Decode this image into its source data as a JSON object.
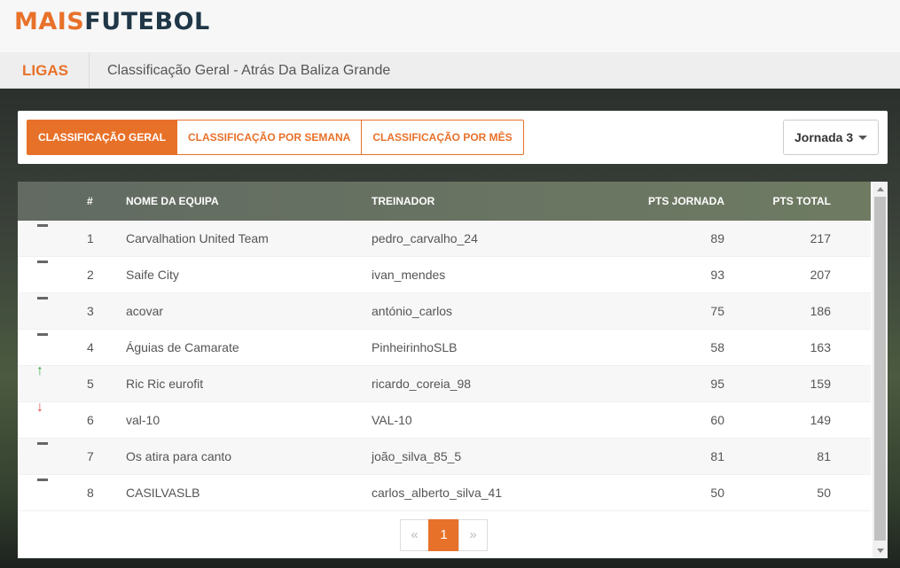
{
  "logo": {
    "part1": "MAIS",
    "part2": "FUTEBOL"
  },
  "subnav": {
    "section": "LIGAS",
    "title": "Classificação Geral - Atrás Da Baliza Grande"
  },
  "tabs": [
    {
      "label": "Classificação Geral",
      "active": true
    },
    {
      "label": "Classificação por Semana",
      "active": false
    },
    {
      "label": "Classificação por Mês",
      "active": false
    }
  ],
  "round_select": {
    "value": "Jornada 3"
  },
  "table": {
    "headers": {
      "num": "#",
      "team": "Nome da Equipa",
      "coach": "Treinador",
      "pts_round": "PTS Jornada",
      "pts_total": "PTS Total"
    },
    "rows": [
      {
        "trend": "same",
        "pos": "1",
        "team": "Carvalhation United Team",
        "coach": "pedro_carvalho_24",
        "pts_round": "89",
        "pts_total": "217"
      },
      {
        "trend": "same",
        "pos": "2",
        "team": "Saife City",
        "coach": "ivan_mendes",
        "pts_round": "93",
        "pts_total": "207"
      },
      {
        "trend": "same",
        "pos": "3",
        "team": "acovar",
        "coach": "antónio_carlos",
        "pts_round": "75",
        "pts_total": "186"
      },
      {
        "trend": "same",
        "pos": "4",
        "team": "Águias de Camarate",
        "coach": "PinheirinhoSLB",
        "pts_round": "58",
        "pts_total": "163"
      },
      {
        "trend": "up",
        "pos": "5",
        "team": "Ric Ric eurofit",
        "coach": "ricardo_coreia_98",
        "pts_round": "95",
        "pts_total": "159"
      },
      {
        "trend": "down",
        "pos": "6",
        "team": "val-10",
        "coach": "VAL-10",
        "pts_round": "60",
        "pts_total": "149"
      },
      {
        "trend": "same",
        "pos": "7",
        "team": "Os atira para canto",
        "coach": "joão_silva_85_5",
        "pts_round": "81",
        "pts_total": "81"
      },
      {
        "trend": "same",
        "pos": "8",
        "team": "CASILVASLB",
        "coach": "carlos_alberto_silva_41",
        "pts_round": "50",
        "pts_total": "50"
      }
    ]
  },
  "pagination": {
    "prev": "«",
    "current": "1",
    "next": "»"
  },
  "colors": {
    "accent": "#e8712a",
    "logo_dark": "#1f3747",
    "up": "#3aa845",
    "down": "#e04848"
  }
}
